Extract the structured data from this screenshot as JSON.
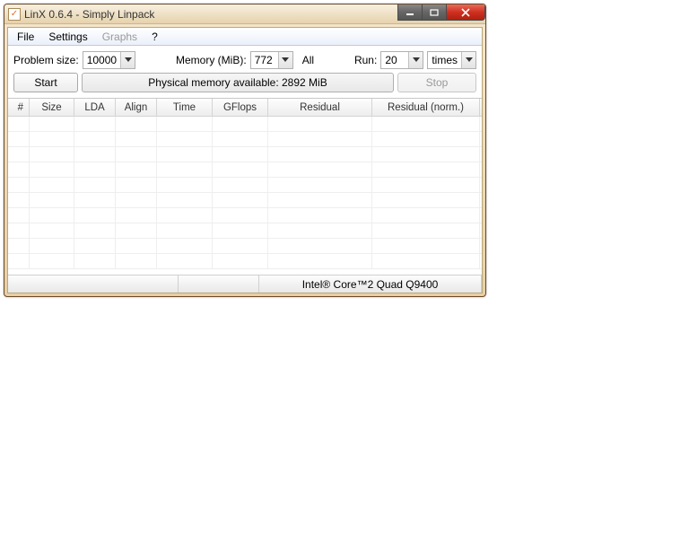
{
  "window": {
    "title": "LinX 0.6.4 - Simply Linpack"
  },
  "menu": {
    "file": "File",
    "settings": "Settings",
    "graphs": "Graphs",
    "help": "?"
  },
  "controls": {
    "problem_size_label": "Problem size:",
    "problem_size_value": "10000",
    "memory_label": "Memory (MiB):",
    "memory_value": "772",
    "all_label": "All",
    "run_label": "Run:",
    "run_value": "20",
    "mode_value": "times"
  },
  "buttons": {
    "start": "Start",
    "stop": "Stop",
    "status_mid": "Physical memory available: 2892 MiB"
  },
  "grid": {
    "headers": {
      "num": "#",
      "size": "Size",
      "lda": "LDA",
      "align": "Align",
      "time": "Time",
      "gflops": "GFlops",
      "residual": "Residual",
      "residual_norm": "Residual (norm.)"
    }
  },
  "status": {
    "cpu": "Intel® Core™2 Quad Q9400"
  }
}
